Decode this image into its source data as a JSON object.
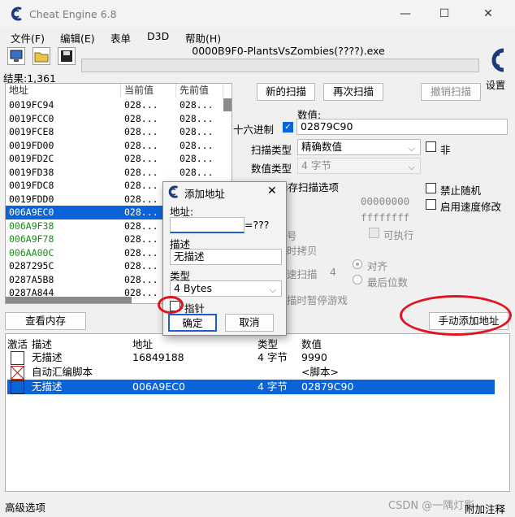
{
  "window": {
    "title": "Cheat Engine 6.8",
    "controls": {
      "minimize": "—",
      "maximize": "☐",
      "close": "✕"
    }
  },
  "menu": [
    "文件(F)",
    "编辑(E)",
    "表单",
    "D3D",
    "帮助(H)"
  ],
  "process_title": "0000B9F0-PlantsVsZombies(????).exe",
  "results": "结果:1,361",
  "settings_label": "设置",
  "scan_list": {
    "headers": {
      "address": "地址",
      "current": "当前值",
      "previous": "先前值"
    },
    "rows": [
      {
        "address": "0019FC94",
        "current": "028...",
        "previous": "028..."
      },
      {
        "address": "0019FCC0",
        "current": "028...",
        "previous": "028..."
      },
      {
        "address": "0019FCE8",
        "current": "028...",
        "previous": "028..."
      },
      {
        "address": "0019FD00",
        "current": "028...",
        "previous": "028..."
      },
      {
        "address": "0019FD2C",
        "current": "028...",
        "previous": "028..."
      },
      {
        "address": "0019FD38",
        "current": "028...",
        "previous": "028..."
      },
      {
        "address": "0019FDC8",
        "current": "028...",
        "previous": "028..."
      },
      {
        "address": "0019FDD0",
        "current": "028...",
        "previous": "028..."
      },
      {
        "address": "006A9EC0",
        "current": "028...",
        "previous": "028..."
      },
      {
        "address": "006A9F38",
        "current": "028...",
        "previous": "028..."
      },
      {
        "address": "006A9F78",
        "current": "028...",
        "previous": "028..."
      },
      {
        "address": "006AA00C",
        "current": "028...",
        "previous": "028..."
      },
      {
        "address": "0287295C",
        "current": "028...",
        "previous": "028..."
      },
      {
        "address": "0287A5B8",
        "current": "028...",
        "previous": "028..."
      },
      {
        "address": "0287A844",
        "current": "028...",
        "previous": "028..."
      }
    ]
  },
  "scan": {
    "new_scan": "新的扫描",
    "next_scan": "再次扫描",
    "undo_scan": "撤销扫描",
    "value_label": "数值:",
    "hex_label": "十六进制",
    "hex_checked": true,
    "value": "02879C90",
    "scan_type_label": "扫描类型",
    "scan_type": "精确数值",
    "not_label": "非",
    "value_type_label": "数值类型",
    "value_type": "4 字节",
    "memory_options": "内存扫描选项",
    "start_addr": "00000000",
    "end_addr": "ffffffff",
    "executable": "可执行",
    "copy_on_write": "时拷贝",
    "fast_scan": "速扫描",
    "fast_scan_val": "4",
    "align": "对齐",
    "last_digits": "最后位数",
    "pause_game": "描时暂停游戏",
    "disable_random": "禁止随机",
    "enable_speedhack": "启用速度修改",
    "partial_hao": "号"
  },
  "view_memory": "查看内存",
  "manual_add": "手动添加地址",
  "address_list": {
    "headers": {
      "active": "激活",
      "description": "描述",
      "address": "地址",
      "type": "类型",
      "value": "数值"
    },
    "rows": [
      {
        "description": "无描述",
        "address": "16849188",
        "type": "4 字节",
        "value": "9990",
        "icon": "checkbox-empty"
      },
      {
        "description": "自动汇编脚本",
        "address": "",
        "type": "",
        "value": "<脚本>",
        "icon": "checkbox-cross"
      },
      {
        "description": "无描述",
        "address": "006A9EC0",
        "type": "4 字节",
        "value": "02879C90",
        "icon": "checkbox-empty"
      }
    ]
  },
  "advanced_options": "高级选项",
  "add_comment": "附加注释",
  "watermark": "CSDN @一隅灯影",
  "dialog": {
    "title": "添加地址",
    "address_label": "地址:",
    "address_value": "",
    "address_result": "=???",
    "description_label": "描述",
    "description_value": "无描述",
    "type_label": "类型",
    "type_value": "4 Bytes",
    "pointer_label": "指针",
    "ok": "确定",
    "cancel": "取消"
  },
  "colors": {
    "selection": "#0a64d8",
    "annotation": "#e0141e",
    "green_address": "#1a8a1a"
  }
}
